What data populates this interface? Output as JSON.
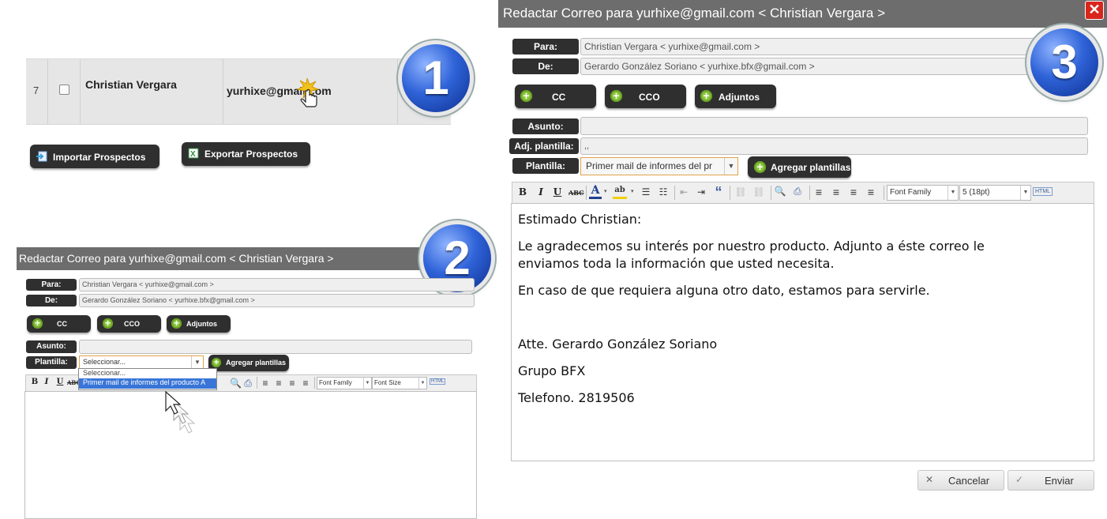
{
  "steps": [
    "1",
    "2",
    "3"
  ],
  "panel1": {
    "row": {
      "index": "7",
      "name": "Christian Vergara",
      "email": "yurhixe@gmail.com"
    },
    "import_label": "Importar Prospectos",
    "export_label": "Exportar Prospectos"
  },
  "panel2": {
    "title": "Redactar Correo para yurhixe@gmail.com < Christian Vergara >",
    "para_label": "Para:",
    "para_value": "Christian  Vergara < yurhixe@gmail.com >",
    "de_label": "De:",
    "de_value": "Gerardo González Soriano < yurhixe.bfx@gmail.com >",
    "cc": "CC",
    "cco": "CCO",
    "adjuntos": "Adjuntos",
    "asunto_label": "Asunto:",
    "plantilla_label": "Plantilla:",
    "plantilla_value": "Seleccionar...",
    "agregar": "Agregar plantillas",
    "options": [
      "Seleccionar...",
      "Primer mail de informes del producto A"
    ],
    "font_family": "Font Family",
    "font_size": "Font Size",
    "html": "HTML"
  },
  "panel3": {
    "title": "Redactar Correo para yurhixe@gmail.com < Christian Vergara >",
    "para_label": "Para:",
    "para_value": "Christian  Vergara < yurhixe@gmail.com >",
    "de_label": "De:",
    "de_value": "Gerardo González Soriano < yurhixe.bfx@gmail.com >",
    "cc": "CC",
    "cco": "CCO",
    "adjuntos": "Adjuntos",
    "asunto_label": "Asunto:",
    "adj_label": "Adj. plantilla:",
    "adj_value": ",,",
    "plantilla_label": "Plantilla:",
    "plantilla_value": "Primer mail de informes del pr",
    "agregar": "Agregar plantillas",
    "font_family": "Font Family",
    "font_size": "5 (18pt)",
    "html": "HTML",
    "body": {
      "greeting": "Estimado Christian:",
      "p1a": "Le agradecemos su interés por nuestro producto. Adjunto a éste correo le",
      "p1b": "enviamos  toda la información que usted necesita.",
      "p2": "En caso de que requiera alguna otro dato, estamos para servirle.",
      "sign": "Atte. Gerardo González Soriano",
      "company": "Grupo BFX",
      "phone": "Telefono. 2819506"
    },
    "cancel": "Cancelar",
    "send": "Enviar"
  }
}
